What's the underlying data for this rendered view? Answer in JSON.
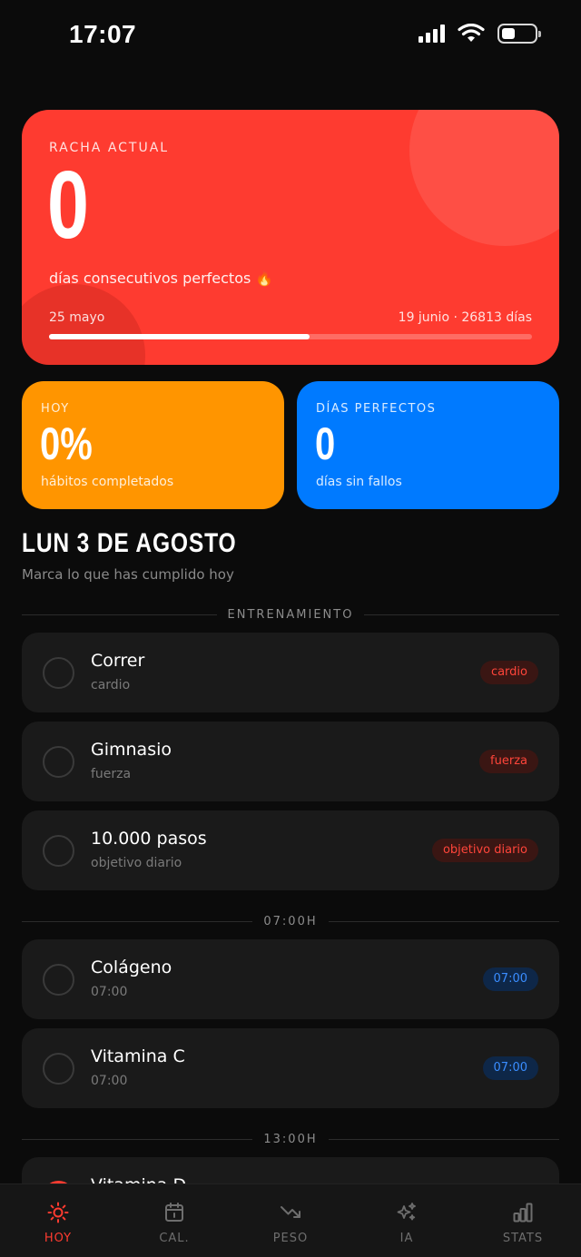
{
  "status_bar": {
    "time": "17:07"
  },
  "streak": {
    "label": "RACHA ACTUAL",
    "value": "0",
    "subtitle": "días consecutivos perfectos 🔥",
    "start_date": "25 mayo",
    "end_info": "19 junio · 26813 días",
    "progress_fraction": 0.54
  },
  "stats": {
    "today": {
      "label": "HOY",
      "value": "0%",
      "subtitle": "hábitos completados",
      "color": "#ff9500"
    },
    "perfect_days": {
      "label": "DÍAS PERFECTOS",
      "value": "0",
      "subtitle": "días sin fallos",
      "color": "#007aff"
    }
  },
  "day": {
    "title": "LUN 3 DE AGOSTO",
    "subtitle": "Marca lo que has cumplido hoy"
  },
  "sections": [
    {
      "header": "ENTRENAMIENTO",
      "habits": [
        {
          "name": "Correr",
          "meta": "cardio",
          "tag": "cardio"
        },
        {
          "name": "Gimnasio",
          "meta": "fuerza",
          "tag": "fuerza"
        },
        {
          "name": "10.000 pasos",
          "meta": "objetivo diario",
          "tag": "objetivo diario"
        }
      ]
    },
    {
      "header": "07:00H",
      "habits": [
        {
          "name": "Colágeno",
          "meta": "07:00",
          "tag": "07:00"
        },
        {
          "name": "Vitamina C",
          "meta": "07:00",
          "tag": "07:00"
        }
      ]
    },
    {
      "header": "13:00H",
      "habits": [
        {
          "name": "Vitamina D"
        }
      ]
    }
  ],
  "tabs": [
    {
      "label": "HOY",
      "icon": "sun-icon",
      "active": true
    },
    {
      "label": "CAL.",
      "icon": "calendar-icon",
      "active": false
    },
    {
      "label": "PESO",
      "icon": "trend-down-icon",
      "active": false
    },
    {
      "label": "IA",
      "icon": "sparkles-icon",
      "active": false
    },
    {
      "label": "STATS",
      "icon": "bar-chart-icon",
      "active": false
    }
  ],
  "colors": {
    "accent": "#ff3b30",
    "streak_bg": "#fe3b30",
    "tag_red": "#ff453a",
    "tag_blue": "#3a8dff"
  }
}
